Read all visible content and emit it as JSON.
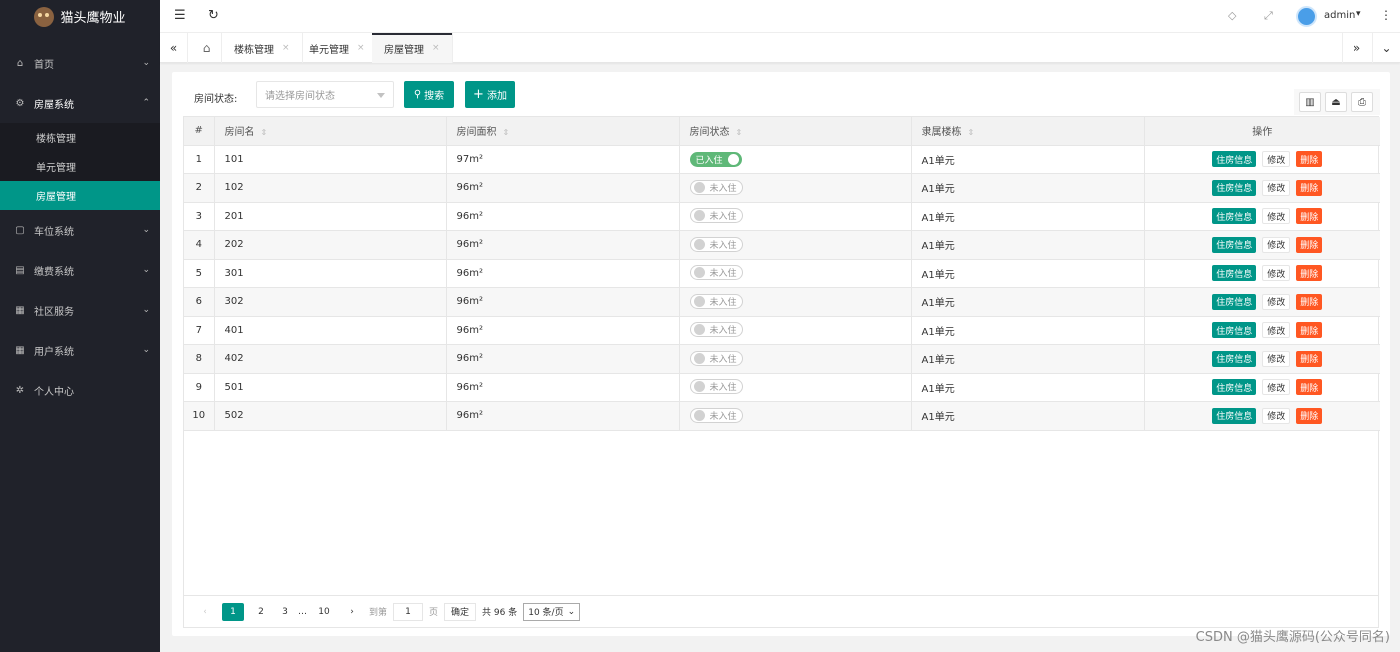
{
  "app": {
    "title": "猫头鹰物业"
  },
  "sidebar": {
    "items": [
      {
        "label": "首页",
        "icon": "home-icon",
        "glyph": "⌂",
        "chevron": "⌄"
      },
      {
        "label": "房屋系统",
        "icon": "gear-icon",
        "glyph": "⚙",
        "chevron": "⌃"
      },
      {
        "label": "车位系统",
        "icon": "cube-icon",
        "glyph": "▢",
        "chevron": "⌄"
      },
      {
        "label": "缴费系统",
        "icon": "book-icon",
        "glyph": "▤",
        "chevron": "⌄"
      },
      {
        "label": "社区服务",
        "icon": "grid-icon",
        "glyph": "▦",
        "chevron": "⌄"
      },
      {
        "label": "用户系统",
        "icon": "users-icon",
        "glyph": "▦",
        "chevron": "⌄"
      },
      {
        "label": "个人中心",
        "icon": "settings-icon",
        "glyph": "✲"
      }
    ],
    "sub_items": [
      "楼栋管理",
      "单元管理",
      "房屋管理"
    ]
  },
  "header": {
    "menu_glyph": "☰",
    "refresh_glyph": "↻",
    "tag_glyph": "◇",
    "fullscreen_glyph": "⤢",
    "user": "admin",
    "caret": "▾",
    "more_glyph": "⋮"
  },
  "tabs": {
    "prev_glyph": "«",
    "next_glyph": "»",
    "down_glyph": "⌄",
    "home_glyph": "⌂",
    "close_glyph": "×",
    "items": [
      "楼栋管理",
      "单元管理",
      "房屋管理"
    ]
  },
  "filter": {
    "label": "房间状态:",
    "placeholder": "请选择房间状态",
    "search_label": "搜索",
    "search_glyph": "⚲",
    "add_label": "添加",
    "add_glyph": "+"
  },
  "toolbar": {
    "columns_glyph": "▥",
    "export_glyph": "⏏",
    "print_glyph": "⎙"
  },
  "table": {
    "sort_glyph": "⇕",
    "headers": [
      "#",
      "房间名",
      "房间面积",
      "房间状态",
      "隶属楼栋",
      "操作"
    ],
    "rows": [
      {
        "no": "1",
        "name": "101",
        "area": "97m²",
        "status": "已入住",
        "occupied": true,
        "building": "A1单元"
      },
      {
        "no": "2",
        "name": "102",
        "area": "96m²",
        "status": "未入住",
        "occupied": false,
        "building": "A1单元"
      },
      {
        "no": "3",
        "name": "201",
        "area": "96m²",
        "status": "未入住",
        "occupied": false,
        "building": "A1单元"
      },
      {
        "no": "4",
        "name": "202",
        "area": "96m²",
        "status": "未入住",
        "occupied": false,
        "building": "A1单元"
      },
      {
        "no": "5",
        "name": "301",
        "area": "96m²",
        "status": "未入住",
        "occupied": false,
        "building": "A1单元"
      },
      {
        "no": "6",
        "name": "302",
        "area": "96m²",
        "status": "未入住",
        "occupied": false,
        "building": "A1单元"
      },
      {
        "no": "7",
        "name": "401",
        "area": "96m²",
        "status": "未入住",
        "occupied": false,
        "building": "A1单元"
      },
      {
        "no": "8",
        "name": "402",
        "area": "96m²",
        "status": "未入住",
        "occupied": false,
        "building": "A1单元"
      },
      {
        "no": "9",
        "name": "501",
        "area": "96m²",
        "status": "未入住",
        "occupied": false,
        "building": "A1单元"
      },
      {
        "no": "10",
        "name": "502",
        "area": "96m²",
        "status": "未入住",
        "occupied": false,
        "building": "A1单元"
      }
    ],
    "actions": {
      "info": "住房信息",
      "edit": "修改",
      "delete": "删除"
    }
  },
  "pagination": {
    "prev_glyph": "‹",
    "next_glyph": "›",
    "pages": [
      "1",
      "2",
      "3"
    ],
    "ellipsis": "…",
    "last": "10",
    "goto_label": "到第",
    "goto_value": "1",
    "page_suffix": "页",
    "confirm": "确定",
    "total": "共 96 条",
    "page_size": "10 条/页",
    "select_caret": "⌄"
  },
  "watermark": "CSDN @猫头鹰源码(公众号同名)",
  "colors": {
    "primary": "#009688",
    "danger": "#ff5722",
    "switch_on": "#5fb878",
    "sidebar": "#20222a"
  }
}
